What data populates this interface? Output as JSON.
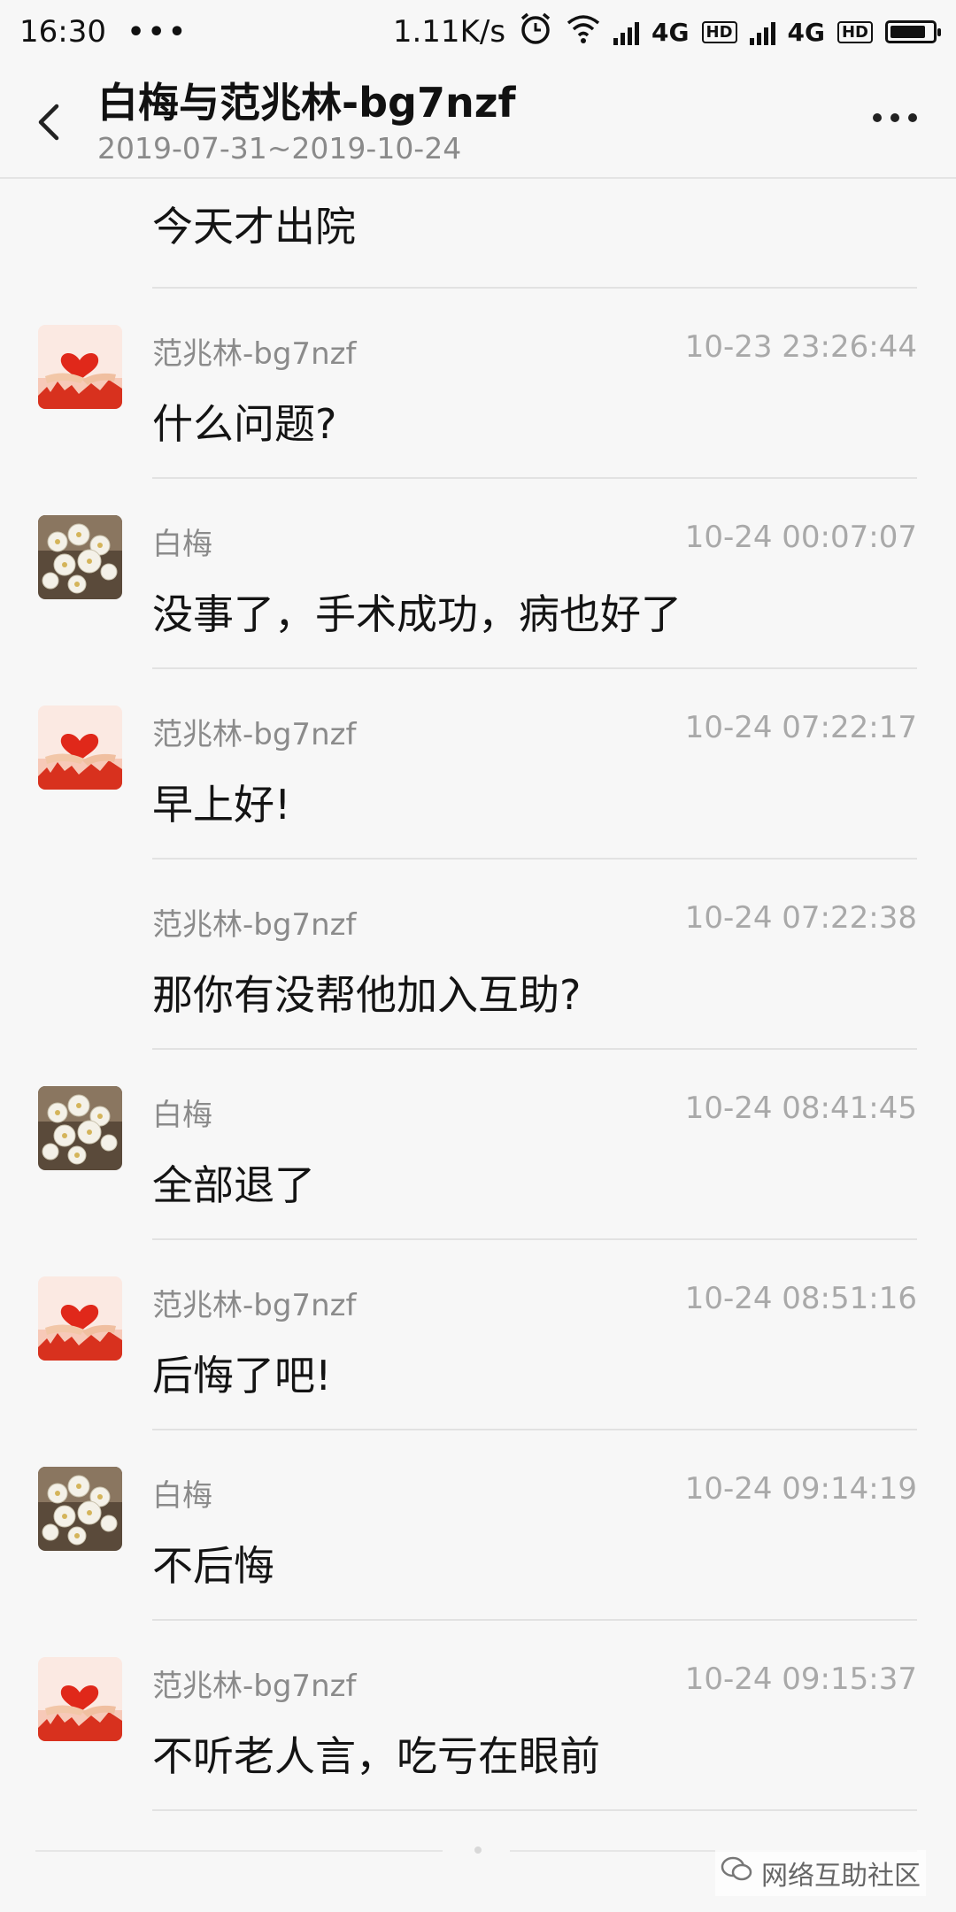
{
  "status_bar": {
    "time": "16:30",
    "more": "•••",
    "speed": "1.11K/s",
    "net1": "4G",
    "hd1": "HD",
    "net2": "4G",
    "hd2": "HD",
    "battery_level": 0.85,
    "icons": [
      "alarm-icon",
      "wifi-icon",
      "signal-icon",
      "battery-icon"
    ]
  },
  "header": {
    "title": "白梅与范兆林-bg7nzf",
    "subtitle": "2019-07-31~2019-10-24"
  },
  "first_message": {
    "text": "今天才出院"
  },
  "messages": [
    {
      "avatar": "heart",
      "sender": "范兆林-bg7nzf",
      "time": "10-23 23:26:44",
      "text": "什么问题?"
    },
    {
      "avatar": "flower",
      "sender": "白梅",
      "time": "10-24 00:07:07",
      "text": "没事了，手术成功，病也好了"
    },
    {
      "avatar": "heart",
      "sender": "范兆林-bg7nzf",
      "time": "10-24 07:22:17",
      "text": "早上好!"
    },
    {
      "avatar": "none",
      "sender": "范兆林-bg7nzf",
      "time": "10-24 07:22:38",
      "text": "那你有没帮他加入互助?"
    },
    {
      "avatar": "flower",
      "sender": "白梅",
      "time": "10-24 08:41:45",
      "text": "全部退了"
    },
    {
      "avatar": "heart",
      "sender": "范兆林-bg7nzf",
      "time": "10-24 08:51:16",
      "text": "后悔了吧!"
    },
    {
      "avatar": "flower",
      "sender": "白梅",
      "time": "10-24 09:14:19",
      "text": "不后悔"
    },
    {
      "avatar": "heart",
      "sender": "范兆林-bg7nzf",
      "time": "10-24 09:15:37",
      "text": "不听老人言，吃亏在眼前"
    }
  ],
  "watermark": {
    "text": "网络互助社区"
  }
}
